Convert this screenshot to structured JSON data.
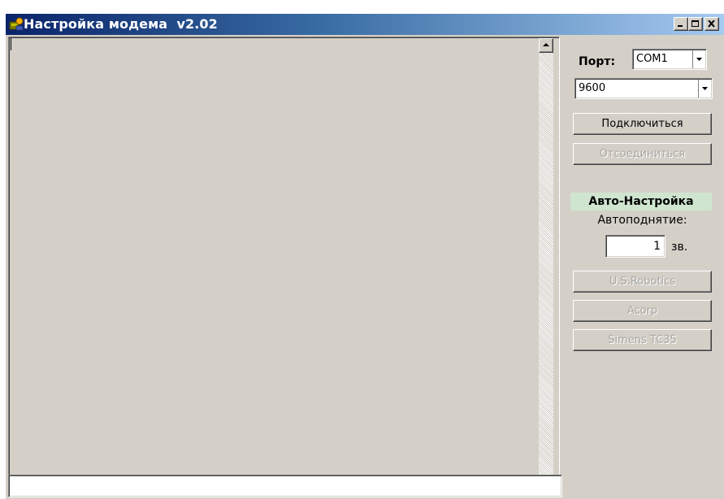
{
  "window": {
    "title": "Настройка модема  v2.02"
  },
  "title_buttons": {
    "minimize_icon": "minimize-icon",
    "maximize_icon": "maximize-icon",
    "close_icon": "close-icon"
  },
  "log": {
    "text": ""
  },
  "command": {
    "value": ""
  },
  "connection": {
    "port_label": "Порт:",
    "port_value": "COM1",
    "speed_value": "9600",
    "connect_label": "Подключиться",
    "disconnect_label": "Отсоединиться"
  },
  "auto_setup": {
    "header": "Авто-Настройка",
    "autoanswer_label": "Автоподнятие:",
    "rings_value": "1",
    "rings_unit": "зв.",
    "buttons": [
      "U.S.Robotics",
      "Acorp",
      "Simens TC35"
    ]
  },
  "colors": {
    "face": "#d4d0c8",
    "title_start": "#0a246a",
    "title_end": "#a6caf0",
    "section_bg": "#cfe5cf",
    "disabled_text": "#a8a6a0"
  }
}
